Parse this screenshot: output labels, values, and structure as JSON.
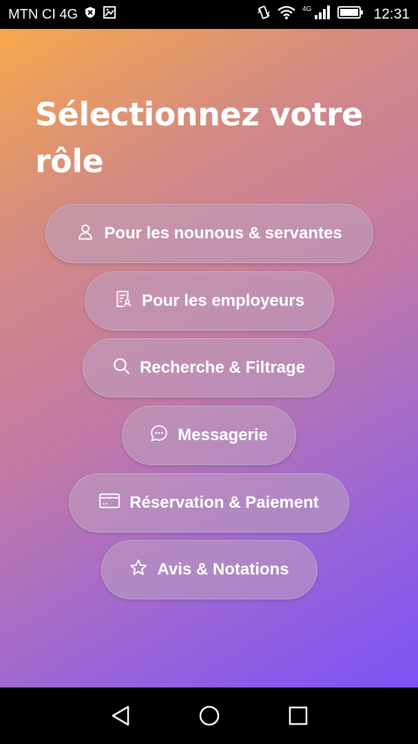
{
  "status_bar": {
    "carrier": "MTN CI 4G",
    "network_badge": "4G",
    "time": "12:31"
  },
  "title": "Sélectionnez votre rôle",
  "roles": [
    {
      "label": "Pour les nounous & servantes",
      "icon": "user-icon"
    },
    {
      "label": "Pour les employeurs",
      "icon": "id-card-icon"
    },
    {
      "label": "Recherche & Filtrage",
      "icon": "search-icon"
    },
    {
      "label": "Messagerie",
      "icon": "chat-icon"
    },
    {
      "label": "Réservation & Paiement",
      "icon": "credit-card-icon"
    },
    {
      "label": "Avis & Notations",
      "icon": "star-icon"
    }
  ],
  "navigation": {
    "back": "back-icon",
    "home": "home-icon",
    "recents": "recents-icon"
  },
  "colors": {
    "gradient_start": "#f7a84c",
    "gradient_end": "#7e52f7"
  }
}
